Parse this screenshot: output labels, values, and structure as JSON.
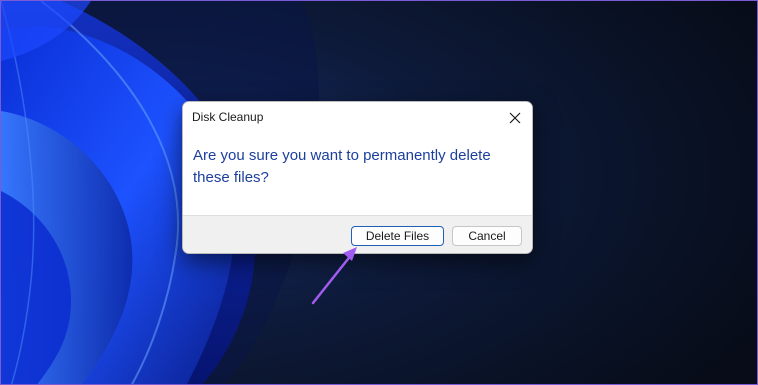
{
  "dialog": {
    "title": "Disk Cleanup",
    "message": "Are you sure you want to permanently delete these files?",
    "buttons": {
      "delete_label": "Delete Files",
      "cancel_label": "Cancel"
    },
    "close_icon": "close-icon"
  },
  "annotation": {
    "arrow_color": "#a05cf0"
  },
  "colors": {
    "message_text": "#1c3f9e",
    "primary_button_border": "#1f5fb9",
    "desktop_background": "#0b1120"
  }
}
